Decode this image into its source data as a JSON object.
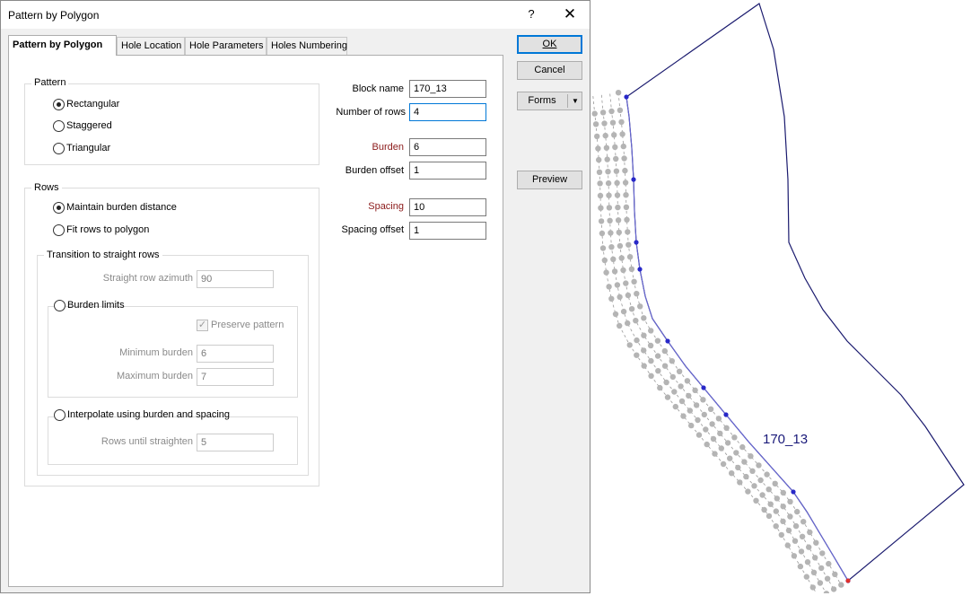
{
  "window": {
    "title": "Pattern by Polygon",
    "help_symbol": "?",
    "close_symbol": "✕"
  },
  "tabs": [
    {
      "label": "Pattern by Polygon",
      "active": true
    },
    {
      "label": "Hole Location",
      "active": false
    },
    {
      "label": "Hole Parameters",
      "active": false
    },
    {
      "label": "Holes Numbering",
      "active": false
    }
  ],
  "pattern": {
    "legend": "Pattern",
    "options": [
      {
        "label": "Rectangular",
        "checked": true
      },
      {
        "label": "Staggered",
        "checked": false
      },
      {
        "label": "Triangular",
        "checked": false
      }
    ]
  },
  "rows": {
    "legend": "Rows",
    "options": [
      {
        "label": "Maintain burden distance",
        "checked": true
      },
      {
        "label": "Fit rows to polygon",
        "checked": false
      }
    ],
    "transition": {
      "legend": "Transition to straight rows",
      "azimuth_label": "Straight row azimuth",
      "azimuth_value": "90",
      "burden_limits": {
        "legend": "Burden limits",
        "preserve_label": "Preserve pattern",
        "preserve_checked": true,
        "min_label": "Minimum burden",
        "min_value": "6",
        "max_label": "Maximum burden",
        "max_value": "7"
      },
      "interpolate": {
        "legend": "Interpolate using burden and spacing",
        "rows_label": "Rows until straighten",
        "rows_value": "5"
      }
    }
  },
  "fields": {
    "block_name_label": "Block name",
    "block_name": "170_13",
    "num_rows_label": "Number of rows",
    "num_rows": "4",
    "burden_label": "Burden",
    "burden": "6",
    "burden_offset_label": "Burden offset",
    "burden_offset": "1",
    "spacing_label": "Spacing",
    "spacing": "10",
    "spacing_offset_label": "Spacing offset",
    "spacing_offset": "1"
  },
  "buttons": {
    "ok": "OK",
    "cancel": "Cancel",
    "forms": "Forms",
    "forms_caret": "▼",
    "preview": "Preview"
  },
  "preview": {
    "block_label": "170_13",
    "colors": {
      "boundary": "#1a1a6e",
      "holes": "#b4b4b4",
      "row_line": "#9a9a9a",
      "edge_line": "#6a6ad8",
      "edge_points": "#2828c8",
      "start_point": "#e0302a"
    }
  }
}
